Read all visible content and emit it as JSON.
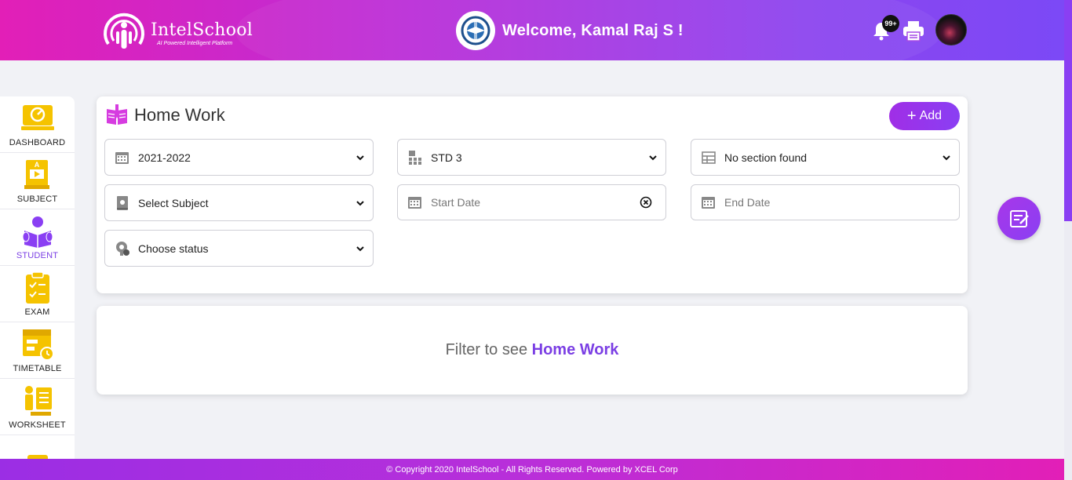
{
  "header": {
    "logo_name": "IntelSchool",
    "logo_tagline": "AI Powered Intelligent Platform",
    "welcome": "Welcome, Kamal Raj S !",
    "notification_count": "99+",
    "brand_gradient": [
      "#e21fb7",
      "#7b49f6"
    ]
  },
  "sidebar": {
    "items": [
      {
        "label": "DASHBOARD",
        "icon": "dashboard-icon"
      },
      {
        "label": "SUBJECT",
        "icon": "subject-icon"
      },
      {
        "label": "STUDENT",
        "icon": "student-icon",
        "active": true
      },
      {
        "label": "EXAM",
        "icon": "exam-clipboard-icon"
      },
      {
        "label": "TIMETABLE",
        "icon": "timetable-icon"
      },
      {
        "label": "WORKSHEET",
        "icon": "worksheet-icon"
      },
      {
        "label": "",
        "icon": "idea-icon"
      }
    ]
  },
  "page": {
    "title": "Home Work",
    "add_label": "Add",
    "accent": "#7b3fe4"
  },
  "filters": {
    "academic_year": "2021-2022",
    "standard": "STD 3",
    "section": "No section found",
    "subject": "Select Subject",
    "start_date_placeholder": "Start Date",
    "end_date_placeholder": "End Date",
    "status": "Choose status"
  },
  "result": {
    "prefix": "Filter to see",
    "highlight": "Home Work"
  },
  "footer": {
    "text": "© Copyright 2020 IntelSchool - All Rights Reserved. Powered by XCEL Corp"
  }
}
